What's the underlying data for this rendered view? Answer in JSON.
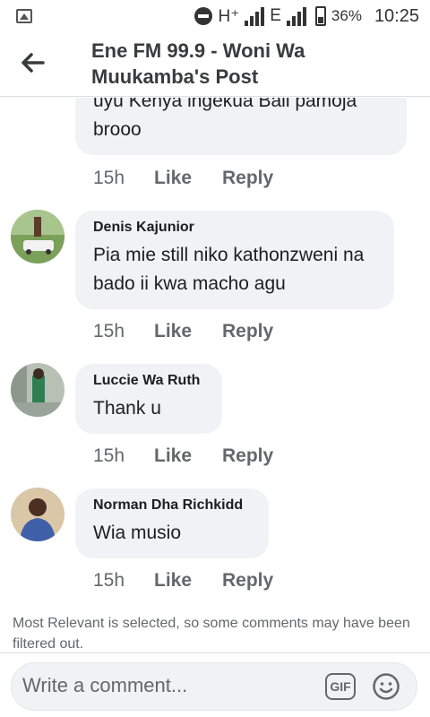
{
  "status_bar": {
    "network_1": "H⁺",
    "network_2": "E",
    "battery": "36%",
    "time": "10:25"
  },
  "header": {
    "title": "Ene FM 99.9 - Woni Wa Muukamba's Post"
  },
  "comments": [
    {
      "author": "",
      "text": "uyu Kenya ingekua Bali pamoja brooo",
      "time": "15h",
      "like": "Like",
      "reply": "Reply"
    },
    {
      "author": "Denis Kajunior",
      "text": "Pia mie still niko kathonzweni na bado ii kwa macho agu",
      "time": "15h",
      "like": "Like",
      "reply": "Reply"
    },
    {
      "author": "Luccie Wa Ruth",
      "text": "Thank u",
      "time": "15h",
      "like": "Like",
      "reply": "Reply"
    },
    {
      "author": "Norman Dha Richkidd",
      "text": "Wia musio",
      "time": "15h",
      "like": "Like",
      "reply": "Reply"
    }
  ],
  "filter_note": "Most Relevant is selected, so some comments may have been filtered out.",
  "composer": {
    "placeholder": "Write a comment...",
    "gif_label": "GIF"
  },
  "colors": {
    "bubble": "#f0f2f5",
    "meta_text": "#65676b",
    "primary_text": "#1c1e21"
  }
}
